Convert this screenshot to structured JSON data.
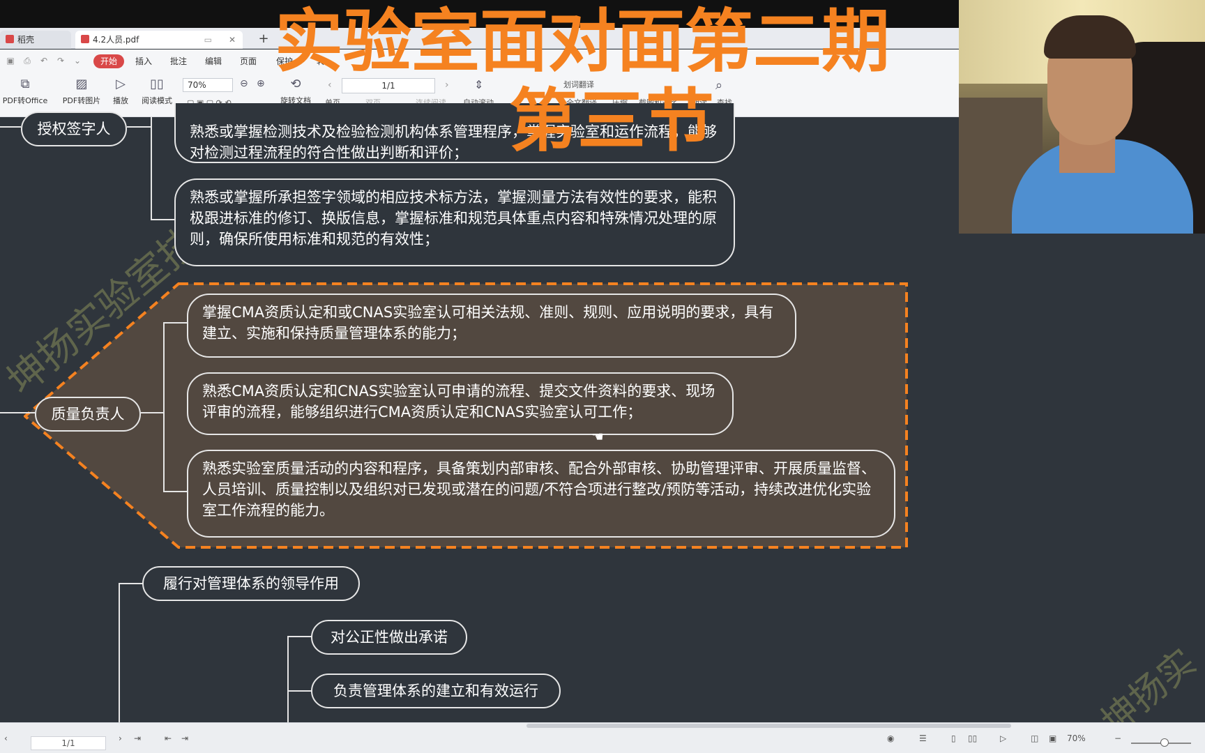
{
  "overlay": {
    "title_line1": "实验室面对面第二期",
    "title_line2": "第三节"
  },
  "tabs": [
    {
      "label": "稻壳",
      "color": "#d94848"
    },
    {
      "label": "4.2人员.pdf",
      "color": "#d94848"
    }
  ],
  "menu": [
    "开始",
    "插入",
    "批注",
    "编辑",
    "页面",
    "保护",
    "转"
  ],
  "toolbar": {
    "items": [
      {
        "label": "PDF转Office",
        "icon": "pdf-convert-icon"
      },
      {
        "label": "PDF转图片",
        "icon": "pdf-image-icon"
      },
      {
        "label": "播放",
        "icon": "play-icon"
      },
      {
        "label": "阅读模式",
        "icon": "book-icon"
      },
      {
        "label": "旋转文档",
        "icon": "rotate-doc-icon"
      }
    ],
    "zoom": "70%",
    "page": "1/1",
    "view_items": [
      "单页",
      "双页",
      "连续阅读",
      "自动滚动"
    ],
    "right_items": [
      "划词翻译",
      "全文翻译",
      "压缩",
      "截图和对比",
      "朗读",
      "查找"
    ]
  },
  "mindmap": {
    "authorized_signatory": {
      "label": "授权签字人",
      "items": [
        "熟悉或掌握检测技术及检验检测机构体系管理程序，掌握实验室和运作流程，能够对检测过程流程的符合性做出判断和评价；",
        "熟悉或掌握所承担签字领域的相应技术标方法，掌握测量方法有效性的要求，能积极跟进标准的修订、换版信息，掌握标准和规范具体重点内容和特殊情况处理的原则，确保所使用标准和规范的有效性；"
      ]
    },
    "quality_manager": {
      "label": "质量负责人",
      "items": [
        "掌握CMA资质认定和或CNAS实验室认可相关法规、准则、规则、应用说明的要求，具有建立、实施和保持质量管理体系的能力；",
        "熟悉CMA资质认定和CNAS实验室认可申请的流程、提交文件资料的要求、现场评审的流程，能够组织进行CMA资质认定和CNAS实验室认可工作；",
        "熟悉实验室质量活动的内容和程序，具备策划内部审核、配合外部审核、协助管理评审、开展质量监督、人员培训、质量控制以及组织对已发现或潜在的问题/不符合项进行整改/预防等活动，持续改进优化实验室工作流程的能力。"
      ]
    },
    "leadership": {
      "label": "履行对管理体系的领导作用",
      "items": [
        "对公正性做出承诺",
        "负责管理体系的建立和有效运行"
      ]
    }
  },
  "watermark": {
    "text1": "坤扬实验室技术",
    "text2": "坤扬实"
  },
  "statusbar": {
    "page": "1/1",
    "zoom": "70%"
  },
  "colors": {
    "accent_orange": "#f58220",
    "canvas_bg": "#2f353c",
    "box_fill": "#524840",
    "start_button": "#d94848"
  }
}
